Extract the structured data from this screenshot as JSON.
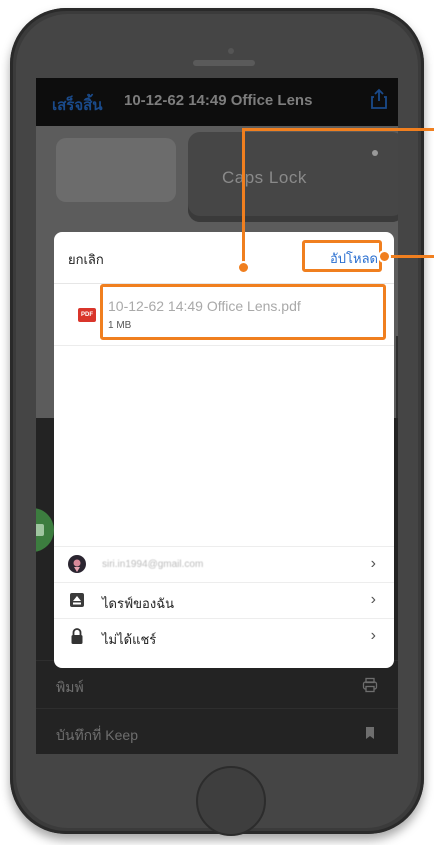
{
  "top_bar": {
    "done_label": "เสร็จสิ้น",
    "title": "10-12-62 14:49 Office Lens"
  },
  "photo": {
    "key_label": "Caps Lock"
  },
  "sheet": {
    "cancel_label": "ยกเลิก",
    "upload_label": "อัปโหลด",
    "file": {
      "icon_text": "PDF",
      "name": "10-12-62 14:49 Office Lens.pdf",
      "size": "1 MB"
    },
    "accounts": [
      {
        "label": "siri.in1994@gmail.com",
        "icon": "avatar-icon"
      },
      {
        "label": "ไดรฟ์ของฉัน",
        "icon": "drive-icon"
      },
      {
        "label": "ไม่ได้แชร์",
        "icon": "lock-icon"
      }
    ],
    "chevron": "›"
  },
  "menu": {
    "print_label": "พิมพ์",
    "keep_label": "บันทึกที่ Keep"
  },
  "colors": {
    "callout": "#f07f1f",
    "upload_text": "#2a6fd0",
    "pdf_red": "#d9352b"
  }
}
